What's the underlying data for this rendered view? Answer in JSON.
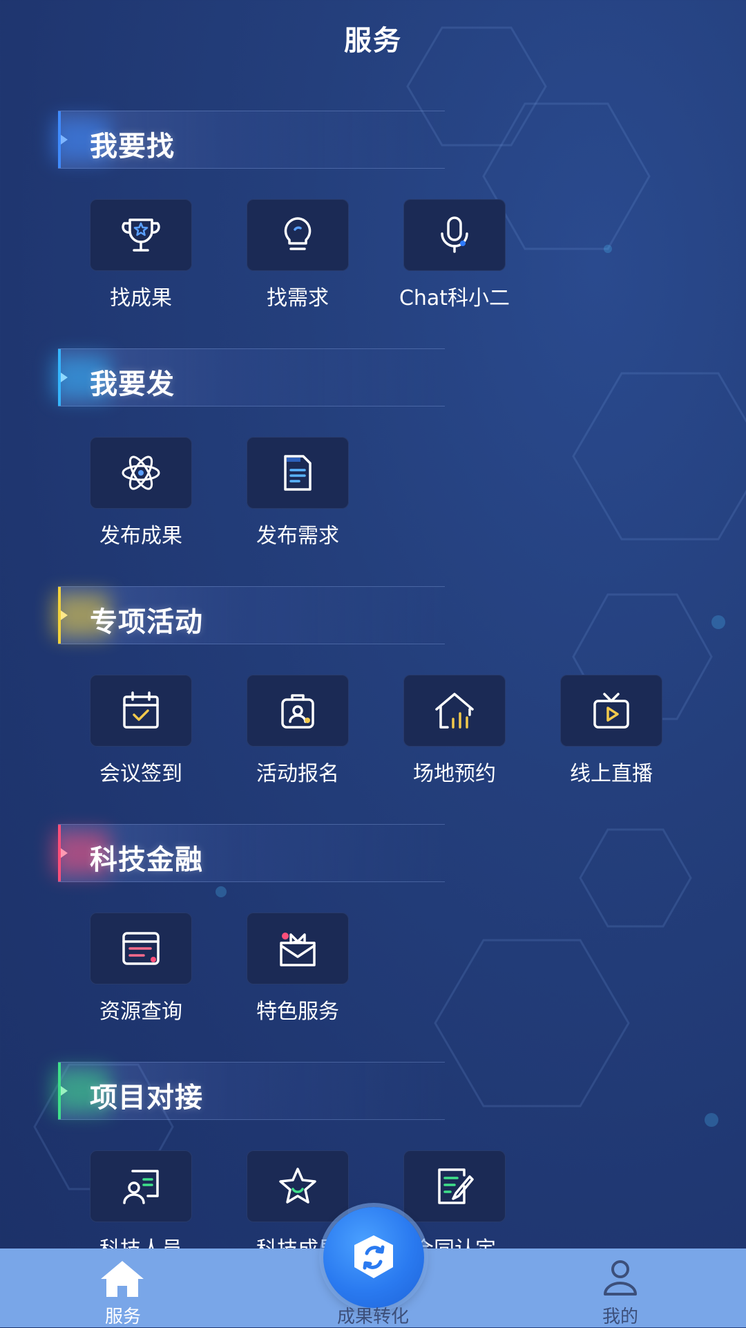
{
  "header": {
    "title": "服务"
  },
  "sections": [
    {
      "title": "我要找",
      "accent": "#3f8bff",
      "items": [
        {
          "label": "找成果",
          "icon": "trophy-icon"
        },
        {
          "label": "找需求",
          "icon": "lightbulb-icon"
        },
        {
          "label": "Chat科小二",
          "icon": "microphone-icon"
        }
      ]
    },
    {
      "title": "我要发",
      "accent": "#35b6ff",
      "items": [
        {
          "label": "发布成果",
          "icon": "atom-icon"
        },
        {
          "label": "发布需求",
          "icon": "document-icon"
        }
      ]
    },
    {
      "title": "专项活动",
      "accent": "#f2d23c",
      "items": [
        {
          "label": "会议签到",
          "icon": "calendar-check-icon"
        },
        {
          "label": "活动报名",
          "icon": "badge-icon"
        },
        {
          "label": "场地预约",
          "icon": "venue-chart-icon"
        },
        {
          "label": "线上直播",
          "icon": "tv-play-icon"
        }
      ]
    },
    {
      "title": "科技金融",
      "accent": "#ff4f7a",
      "items": [
        {
          "label": "资源查询",
          "icon": "card-list-icon"
        },
        {
          "label": "特色服务",
          "icon": "gift-icon"
        }
      ]
    },
    {
      "title": "项目对接",
      "accent": "#3fe08a",
      "items": [
        {
          "label": "科技人员",
          "icon": "person-board-icon"
        },
        {
          "label": "科技成果",
          "icon": "star-icon"
        },
        {
          "label": "合同认定",
          "icon": "edit-doc-icon"
        }
      ]
    }
  ],
  "tabbar": {
    "tabs": [
      {
        "label": "服务",
        "icon": "home-icon",
        "active": true
      },
      {
        "label": "成果转化",
        "icon": "exchange-icon",
        "active": false
      },
      {
        "label": "我的",
        "icon": "user-icon",
        "active": false
      }
    ]
  }
}
